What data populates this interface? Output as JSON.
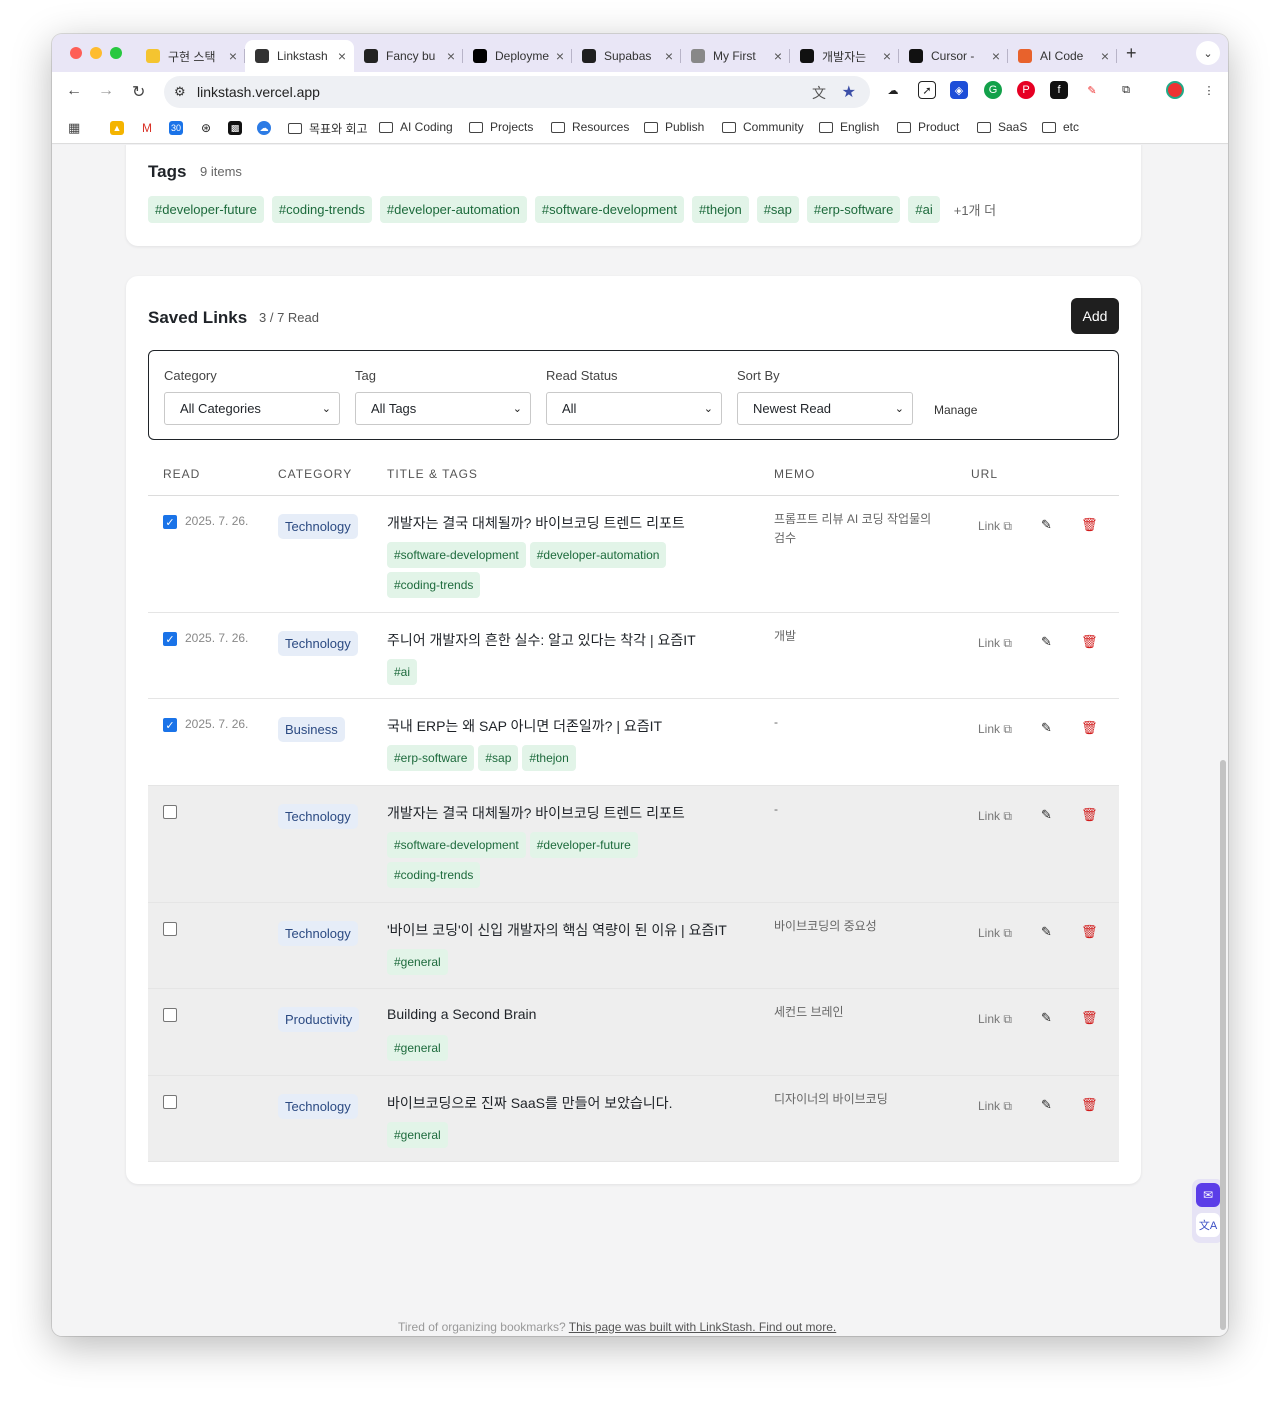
{
  "browser": {
    "tabs": [
      {
        "label": "구현 스택",
        "icon": "star-icon",
        "color": "#f4c430"
      },
      {
        "label": "Linkstash",
        "icon": "link-icon",
        "color": "#333333",
        "active": true
      },
      {
        "label": "Fancy bu",
        "icon": "openai-icon",
        "color": "#222222"
      },
      {
        "label": "Deployme",
        "icon": "vercel-icon",
        "color": "#000000"
      },
      {
        "label": "Supabas",
        "icon": "supabase-icon",
        "color": "#1f1f1f"
      },
      {
        "label": "My First",
        "icon": "gear-icon",
        "color": "#888888"
      },
      {
        "label": "개발자는",
        "icon": "yozm-icon",
        "color": "#111111"
      },
      {
        "label": "Cursor -",
        "icon": "cursor-icon",
        "color": "#111111"
      },
      {
        "label": "AI Code",
        "icon": "fire-icon",
        "color": "#e8622c"
      }
    ],
    "url": "linkstash.vercel.app",
    "bookmarks": [
      "목표와 회고",
      "AI Coding",
      "Projects",
      "Resources",
      "Publish",
      "Community",
      "English",
      "Product",
      "SaaS",
      "etc"
    ]
  },
  "tags_section": {
    "title": "Tags",
    "count": "9 items",
    "tags": [
      "#developer-future",
      "#coding-trends",
      "#developer-automation",
      "#software-development",
      "#thejon",
      "#sap",
      "#erp-software",
      "#ai"
    ],
    "more": "+1개 더"
  },
  "links_section": {
    "title": "Saved Links",
    "count": "3 / 7 Read",
    "add_label": "Add",
    "filters": {
      "category_label": "Category",
      "category_value": "All Categories",
      "tag_label": "Tag",
      "tag_value": "All Tags",
      "read_label": "Read Status",
      "read_value": "All",
      "sort_label": "Sort By",
      "sort_value": "Newest Read",
      "manage_label": "Manage"
    },
    "columns": [
      "READ",
      "CATEGORY",
      "TITLE & TAGS",
      "MEMO",
      "URL"
    ],
    "link_label": "Link ⧉",
    "rows": [
      {
        "read": true,
        "date": "2025. 7. 26.",
        "category": "Technology",
        "title": "개발자는 결국 대체될까? 바이브코딩 트렌드 리포트",
        "tags": [
          "#software-development",
          "#developer-automation",
          "#coding-trends"
        ],
        "memo": "프롬프트 리뷰 AI 코딩 작업물의 검수"
      },
      {
        "read": true,
        "date": "2025. 7. 26.",
        "category": "Technology",
        "title": "주니어 개발자의 흔한 실수: 알고 있다는 착각 | 요즘IT",
        "tags": [
          "#ai"
        ],
        "memo": "개발"
      },
      {
        "read": true,
        "date": "2025. 7. 26.",
        "category": "Business",
        "title": "국내 ERP는 왜 SAP 아니면 더존일까? | 요즘IT",
        "tags": [
          "#erp-software",
          "#sap",
          "#thejon"
        ],
        "memo": "-"
      },
      {
        "read": false,
        "date": "",
        "category": "Technology",
        "title": "개발자는 결국 대체될까? 바이브코딩 트렌드 리포트",
        "tags": [
          "#software-development",
          "#developer-future",
          "#coding-trends"
        ],
        "memo": "-"
      },
      {
        "read": false,
        "date": "",
        "category": "Technology",
        "title": "'바이브 코딩'이 신입 개발자의 핵심 역량이 된 이유 | 요즘IT",
        "tags": [
          "#general"
        ],
        "memo": "바이브코딩의 중요성"
      },
      {
        "read": false,
        "date": "",
        "category": "Productivity",
        "title": "Building a Second Brain",
        "tags": [
          "#general"
        ],
        "memo": "세컨드 브레인"
      },
      {
        "read": false,
        "date": "",
        "category": "Technology",
        "title": "바이브코딩으로 진짜 SaaS를 만들어 보았습니다.",
        "tags": [
          "#general"
        ],
        "memo": "디자이너의 바이브코딩"
      }
    ]
  },
  "footer": {
    "text": "Tired of organizing bookmarks?",
    "link": "This page was built with LinkStash. Find out more."
  }
}
